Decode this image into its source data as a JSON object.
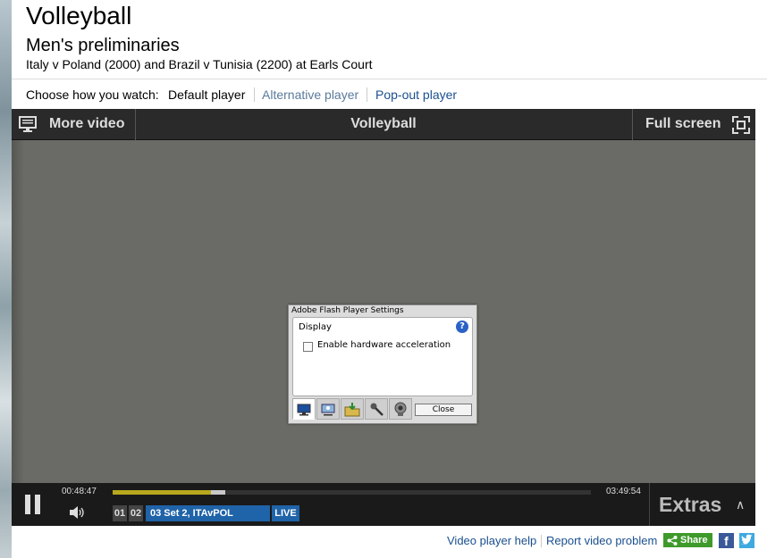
{
  "header": {
    "title": "Volleyball",
    "subtitle": "Men's preliminaries",
    "description": "Italy v Poland (2000) and Brazil v Tunisia (2200) at Earls Court"
  },
  "watch": {
    "label": "Choose how you watch:",
    "options": [
      "Default player",
      "Alternative player",
      "Pop-out player"
    ]
  },
  "player": {
    "more_video": "More video",
    "title": "Volleyball",
    "full_screen": "Full screen",
    "current_time": "00:48:47",
    "duration": "03:49:54",
    "progress_fraction": 0.205,
    "buffer_fraction": 0.235,
    "chips": [
      "01",
      "02"
    ],
    "active_chip": {
      "number": "03",
      "label": "Set 2, ITAvPOL"
    },
    "live": "LIVE",
    "extras": "Extras",
    "colors": {
      "progress": "#b8a81d",
      "active_chip": "#1f63a8"
    }
  },
  "flash_dialog": {
    "title": "Adobe Flash Player Settings",
    "section": "Display",
    "checkbox_label": "Enable hardware acceleration",
    "checkbox_checked": false,
    "close": "Close",
    "tabs": [
      "display-icon",
      "privacy-icon",
      "storage-icon",
      "microphone-icon",
      "camera-icon"
    ]
  },
  "footer": {
    "help": "Video player help",
    "report": "Report video problem",
    "share": "Share",
    "facebook": "f"
  }
}
